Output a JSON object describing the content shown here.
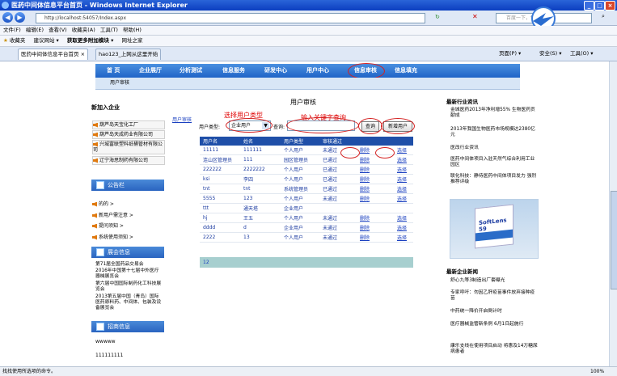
{
  "window": {
    "title": "医药中间体信息平台首页 - Windows Internet Explorer"
  },
  "browser": {
    "url": "http://localhost:54057/Index.aspx",
    "search_placeholder": "百度一下，你",
    "menu": [
      "文件(F)",
      "编辑(E)",
      "查看(V)",
      "收藏夹(A)",
      "工具(T)",
      "帮助(H)"
    ],
    "favorites": {
      "label": "收藏夹",
      "items": [
        "建议网站 ▾",
        "获取更多附加模块 ▾",
        "网址之家"
      ]
    },
    "tabs": [
      "医药中间体信息平台首页",
      "hao123_上网从这里开始"
    ],
    "tools": [
      "页面(P) ▾",
      "安全(S) ▾",
      "工具(O) ▾"
    ]
  },
  "nav": {
    "items": [
      "首  页",
      "企业展厅",
      "分析测试",
      "信息服务",
      "研发中心",
      "用户中心",
      "信息审核",
      "信息填充"
    ],
    "sub": "用户审核"
  },
  "left": {
    "new_company_title": "新加入企业",
    "new_companies": [
      "葫芦岛天宝化工厂",
      "葫芦岛天成药业有限公司",
      "兴城富联塑料纸桶管材有限公司",
      "辽宁海思制药有限公司"
    ],
    "announce_title": "公告栏",
    "announce_items": [
      "的的 >",
      "新用户需注意 >",
      "提问须知 >",
      "系统使用须知 >"
    ],
    "exhibit_title": "展会信息",
    "exhibits": [
      "第71届全国药品交易会",
      "2016年中国第十七届中外医疗器械展览会",
      "第六届中国国际制药化工科技展览会",
      "2013第五届中国（青岛）国际医药原料药、中间体、包装及设备展览会"
    ],
    "recruit_title": "招商信息",
    "recruits": [
      "wwwww",
      "111111111"
    ]
  },
  "center": {
    "title": "用户审核",
    "side_link": "用户审核",
    "filter_label": "用户类型:",
    "filter_value": "企业用户",
    "query_label": "查询:",
    "query_value": "",
    "search_button": "查询",
    "add_button": "新增用户",
    "annot_select": "选择用户类型",
    "annot_input": "输入关键字查询",
    "columns": [
      "用户名",
      "姓名",
      "用户类型",
      "审核通过",
      "",
      ""
    ],
    "rows": [
      [
        "11111",
        "111111",
        "个人用户",
        "未通过",
        "删除",
        "选择"
      ],
      [
        "连山区管理员",
        "111",
        "园区管理员",
        "已通过",
        "删除",
        "选择"
      ],
      [
        "222222",
        "2222222",
        "个人用户",
        "已通过",
        "删除",
        "选择"
      ],
      [
        "ksi",
        "李四",
        "个人用户",
        "已通过",
        "删除",
        "选择"
      ],
      [
        "tnt",
        "tnt",
        "系统管理员",
        "已通过",
        "删除",
        "选择"
      ],
      [
        "5555",
        "123",
        "个人用户",
        "未通过",
        "删除",
        "选择"
      ],
      [
        "ttt",
        "通天塔",
        "企业用户",
        "",
        "",
        ""
      ],
      [
        "hj",
        "王五",
        "个人用户",
        "未通过",
        "删除",
        "选择"
      ],
      [
        "dddd",
        "d",
        "企业用户",
        "未通过",
        "删除",
        "选择"
      ],
      [
        "2222",
        "13",
        "个人用户",
        "未通过",
        "删除",
        "选择"
      ]
    ],
    "pager": "12"
  },
  "right": {
    "industry_title": "最新行业资讯",
    "industry_items": [
      "金城医药2013年净利增55% 生物医药贡献成",
      "2013年我国生物医药市场规模达2380亿元",
      "医改行业资讯",
      "医药中间体项目入驻天然气综合利用工业园区",
      "联化科技：静待医药中间体项目发力 强烈推荐评级"
    ],
    "ad_text": "SoftLens 59",
    "company_title": "最新企业新闻",
    "company_items": [
      "舒心九等3制造出厂套曝光",
      "专家呼吁：勿因乙肝疫苗事件放弃接种疫苗",
      "中药统一降价开启倒计时",
      "医疗器械监管新条例 6月1日起施行",
      "康乐支线在使用项目启动 将惠及14万糖尿病患者"
    ]
  },
  "status": {
    "text": "找找使用所选项的命令。",
    "zoom": "100%"
  }
}
